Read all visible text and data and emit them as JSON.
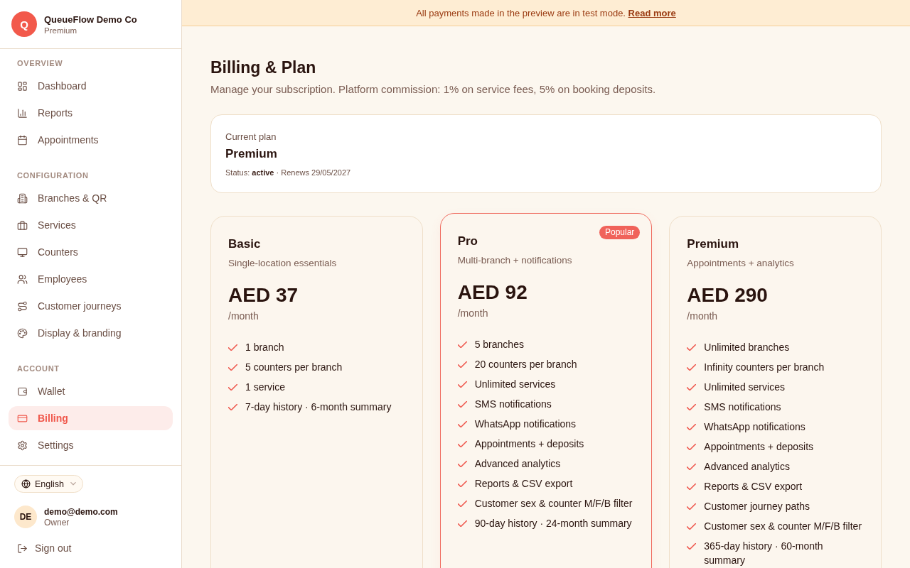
{
  "sidebar": {
    "brand": {
      "initial": "Q",
      "name": "QueueFlow Demo Co",
      "plan": "Premium"
    },
    "sections": [
      {
        "title": "OVERVIEW",
        "items": [
          {
            "label": "Dashboard",
            "selected": false
          },
          {
            "label": "Reports",
            "selected": false
          },
          {
            "label": "Appointments",
            "selected": false
          }
        ]
      },
      {
        "title": "CONFIGURATION",
        "items": [
          {
            "label": "Branches & QR",
            "selected": false
          },
          {
            "label": "Services",
            "selected": false
          },
          {
            "label": "Counters",
            "selected": false
          },
          {
            "label": "Employees",
            "selected": false
          },
          {
            "label": "Customer journeys",
            "selected": false
          },
          {
            "label": "Display & branding",
            "selected": false
          }
        ]
      },
      {
        "title": "ACCOUNT",
        "items": [
          {
            "label": "Wallet",
            "selected": false
          },
          {
            "label": "Billing",
            "selected": true
          },
          {
            "label": "Settings",
            "selected": false
          }
        ]
      }
    ],
    "language": {
      "label": "English"
    },
    "user": {
      "initials": "DE",
      "email": "demo@demo.com",
      "role": "Owner"
    },
    "sign_out": "Sign out"
  },
  "banner": {
    "text": "All payments made in the preview are in test mode.",
    "link": "Read more"
  },
  "page": {
    "title": "Billing & Plan",
    "subtitle": "Manage your subscription. Platform commission: 1% on service fees, 5% on booking deposits."
  },
  "current_plan": {
    "label": "Current plan",
    "name": "Premium",
    "status": "Status: **active** · Renews 29/05/2027"
  },
  "plans": [
    {
      "name": "Basic",
      "tagline": "Single-location essentials",
      "price": "AED 37",
      "period": "/month",
      "highlighted": false,
      "features": [
        "1 branch",
        "5 counters per branch",
        "1 service",
        "7-day history · 6-month summary"
      ]
    },
    {
      "name": "Pro",
      "badge": "Popular",
      "tagline": "Multi-branch + notifications",
      "price": "AED 92",
      "period": "/month",
      "highlighted": true,
      "features": [
        "5 branches",
        "20 counters per branch",
        "Unlimited services",
        "SMS notifications",
        "WhatsApp notifications",
        "Appointments + deposits",
        "Advanced analytics",
        "Reports & CSV export",
        "Customer sex & counter M/F/B filter",
        "90-day history · 24-month summary"
      ]
    },
    {
      "name": "Premium",
      "tagline": "Appointments + analytics",
      "price": "AED 290",
      "period": "/month",
      "highlighted": false,
      "features": [
        "Unlimited branches",
        "Infinity counters per branch",
        "Unlimited services",
        "SMS notifications",
        "WhatsApp notifications",
        "Appointments + deposits",
        "Advanced analytics",
        "Reports & CSV export",
        "Customer journey paths",
        "Customer sex & counter M/F/B filter",
        "365-day history · 60-month summary"
      ]
    }
  ]
}
